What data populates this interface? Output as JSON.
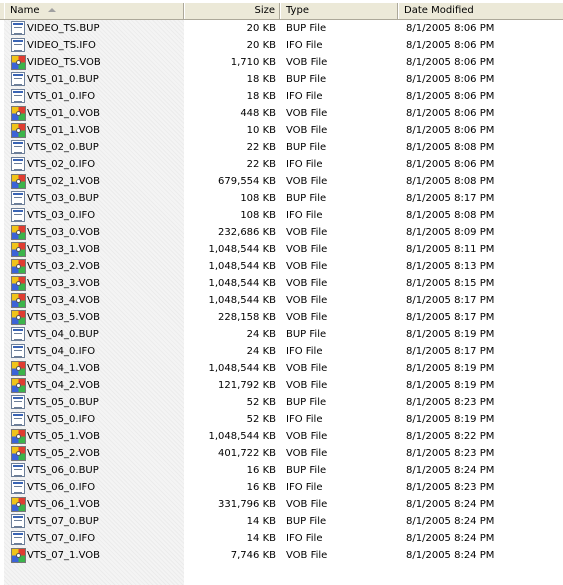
{
  "columns": {
    "name": "Name",
    "size": "Size",
    "type": "Type",
    "date": "Date Modified"
  },
  "files": [
    {
      "name": "VIDEO_TS.BUP",
      "size": "20 KB",
      "type": "BUP File",
      "date": "8/1/2005 8:06 PM",
      "icon": "file-icon"
    },
    {
      "name": "VIDEO_TS.IFO",
      "size": "20 KB",
      "type": "IFO File",
      "date": "8/1/2005 8:06 PM",
      "icon": "file-icon"
    },
    {
      "name": "VIDEO_TS.VOB",
      "size": "1,710 KB",
      "type": "VOB File",
      "date": "8/1/2005 8:06 PM",
      "icon": "vob-media-icon"
    },
    {
      "name": "VTS_01_0.BUP",
      "size": "18 KB",
      "type": "BUP File",
      "date": "8/1/2005 8:06 PM",
      "icon": "file-icon"
    },
    {
      "name": "VTS_01_0.IFO",
      "size": "18 KB",
      "type": "IFO File",
      "date": "8/1/2005 8:06 PM",
      "icon": "file-icon"
    },
    {
      "name": "VTS_01_0.VOB",
      "size": "448 KB",
      "type": "VOB File",
      "date": "8/1/2005 8:06 PM",
      "icon": "vob-media-icon"
    },
    {
      "name": "VTS_01_1.VOB",
      "size": "10 KB",
      "type": "VOB File",
      "date": "8/1/2005 8:06 PM",
      "icon": "vob-media-icon"
    },
    {
      "name": "VTS_02_0.BUP",
      "size": "22 KB",
      "type": "BUP File",
      "date": "8/1/2005 8:08 PM",
      "icon": "file-icon"
    },
    {
      "name": "VTS_02_0.IFO",
      "size": "22 KB",
      "type": "IFO File",
      "date": "8/1/2005 8:06 PM",
      "icon": "file-icon"
    },
    {
      "name": "VTS_02_1.VOB",
      "size": "679,554 KB",
      "type": "VOB File",
      "date": "8/1/2005 8:08 PM",
      "icon": "vob-media-icon"
    },
    {
      "name": "VTS_03_0.BUP",
      "size": "108 KB",
      "type": "BUP File",
      "date": "8/1/2005 8:17 PM",
      "icon": "file-icon"
    },
    {
      "name": "VTS_03_0.IFO",
      "size": "108 KB",
      "type": "IFO File",
      "date": "8/1/2005 8:08 PM",
      "icon": "file-icon"
    },
    {
      "name": "VTS_03_0.VOB",
      "size": "232,686 KB",
      "type": "VOB File",
      "date": "8/1/2005 8:09 PM",
      "icon": "vob-media-icon"
    },
    {
      "name": "VTS_03_1.VOB",
      "size": "1,048,544 KB",
      "type": "VOB File",
      "date": "8/1/2005 8:11 PM",
      "icon": "vob-media-icon"
    },
    {
      "name": "VTS_03_2.VOB",
      "size": "1,048,544 KB",
      "type": "VOB File",
      "date": "8/1/2005 8:13 PM",
      "icon": "vob-media-icon"
    },
    {
      "name": "VTS_03_3.VOB",
      "size": "1,048,544 KB",
      "type": "VOB File",
      "date": "8/1/2005 8:15 PM",
      "icon": "vob-media-icon"
    },
    {
      "name": "VTS_03_4.VOB",
      "size": "1,048,544 KB",
      "type": "VOB File",
      "date": "8/1/2005 8:17 PM",
      "icon": "vob-media-icon"
    },
    {
      "name": "VTS_03_5.VOB",
      "size": "228,158 KB",
      "type": "VOB File",
      "date": "8/1/2005 8:17 PM",
      "icon": "vob-media-icon"
    },
    {
      "name": "VTS_04_0.BUP",
      "size": "24 KB",
      "type": "BUP File",
      "date": "8/1/2005 8:19 PM",
      "icon": "file-icon"
    },
    {
      "name": "VTS_04_0.IFO",
      "size": "24 KB",
      "type": "IFO File",
      "date": "8/1/2005 8:17 PM",
      "icon": "file-icon"
    },
    {
      "name": "VTS_04_1.VOB",
      "size": "1,048,544 KB",
      "type": "VOB File",
      "date": "8/1/2005 8:19 PM",
      "icon": "vob-media-icon"
    },
    {
      "name": "VTS_04_2.VOB",
      "size": "121,792 KB",
      "type": "VOB File",
      "date": "8/1/2005 8:19 PM",
      "icon": "vob-media-icon"
    },
    {
      "name": "VTS_05_0.BUP",
      "size": "52 KB",
      "type": "BUP File",
      "date": "8/1/2005 8:23 PM",
      "icon": "file-icon"
    },
    {
      "name": "VTS_05_0.IFO",
      "size": "52 KB",
      "type": "IFO File",
      "date": "8/1/2005 8:19 PM",
      "icon": "file-icon"
    },
    {
      "name": "VTS_05_1.VOB",
      "size": "1,048,544 KB",
      "type": "VOB File",
      "date": "8/1/2005 8:22 PM",
      "icon": "vob-media-icon"
    },
    {
      "name": "VTS_05_2.VOB",
      "size": "401,722 KB",
      "type": "VOB File",
      "date": "8/1/2005 8:23 PM",
      "icon": "vob-media-icon"
    },
    {
      "name": "VTS_06_0.BUP",
      "size": "16 KB",
      "type": "BUP File",
      "date": "8/1/2005 8:24 PM",
      "icon": "file-icon"
    },
    {
      "name": "VTS_06_0.IFO",
      "size": "16 KB",
      "type": "IFO File",
      "date": "8/1/2005 8:23 PM",
      "icon": "file-icon"
    },
    {
      "name": "VTS_06_1.VOB",
      "size": "331,796 KB",
      "type": "VOB File",
      "date": "8/1/2005 8:24 PM",
      "icon": "vob-media-icon"
    },
    {
      "name": "VTS_07_0.BUP",
      "size": "14 KB",
      "type": "BUP File",
      "date": "8/1/2005 8:24 PM",
      "icon": "file-icon"
    },
    {
      "name": "VTS_07_0.IFO",
      "size": "14 KB",
      "type": "IFO File",
      "date": "8/1/2005 8:24 PM",
      "icon": "file-icon"
    },
    {
      "name": "VTS_07_1.VOB",
      "size": "7,746 KB",
      "type": "VOB File",
      "date": "8/1/2005 8:24 PM",
      "icon": "vob-media-icon"
    }
  ],
  "colors": {
    "header_bg": "#ece9d8",
    "sorted_column_bg": "#f4f4f4",
    "header_border": "#aca899"
  }
}
